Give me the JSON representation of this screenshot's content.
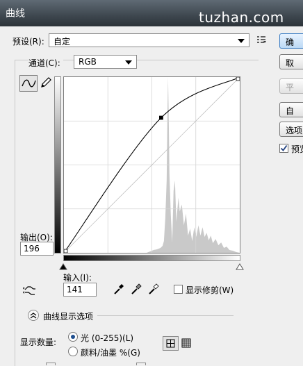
{
  "window": {
    "title": "曲线",
    "watermark": "tuzhan.com"
  },
  "preset": {
    "label": "预设(R):",
    "value": "自定",
    "menu_icon": "preset-options-icon"
  },
  "channel": {
    "label": "通道(C):",
    "value": "RGB"
  },
  "tools": {
    "curve_tool": "curve-point-icon",
    "pencil_tool": "pencil-icon",
    "target_adjust": "targeted-adjustment-icon"
  },
  "output": {
    "label": "输出(O):",
    "value": "196"
  },
  "input": {
    "label": "输入(I):",
    "value": "141"
  },
  "eyedroppers": [
    "black-point-eyedropper-icon",
    "gray-point-eyedropper-icon",
    "white-point-eyedropper-icon"
  ],
  "show_clipping": {
    "label": "显示修剪(W)",
    "checked": false
  },
  "curve_display": {
    "label": "曲线显示选项"
  },
  "show_amount": {
    "label": "显示数量:",
    "options": [
      {
        "label": "光 (0-255)(L)",
        "selected": true
      },
      {
        "label": "颜料/油墨 %(G)",
        "selected": false
      }
    ]
  },
  "grid_icons": [
    "simple-grid-icon",
    "detailed-grid-icon"
  ],
  "buttons": {
    "ok": "确",
    "cancel": "取",
    "smooth": "平",
    "auto": "自",
    "options": "选项",
    "preview": "预览"
  },
  "preview": {
    "checked": true
  },
  "curve": {
    "control_points": [
      [
        0,
        0
      ],
      [
        141,
        196
      ],
      [
        255,
        255
      ]
    ]
  }
}
